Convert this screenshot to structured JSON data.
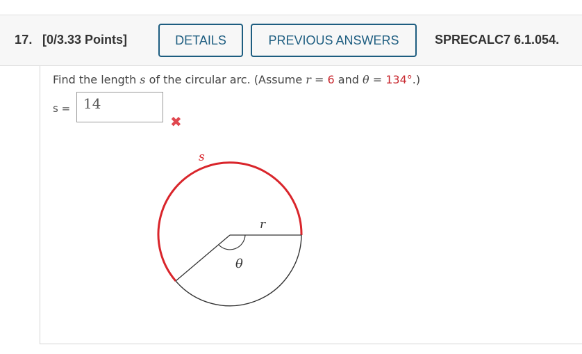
{
  "header": {
    "question_number": "17.",
    "points": "[0/3.33 Points]",
    "details_button": "DETAILS",
    "previous_answers_button": "PREVIOUS ANSWERS",
    "source": "SPRECALC7 6.1.054."
  },
  "question": {
    "prefix": "Find the length ",
    "s_var": "s",
    "middle": " of the circular arc. (Assume ",
    "r_var": "r",
    "eq1": " = ",
    "r_value": "6",
    "and": " and ",
    "theta_var": "θ",
    "eq2": " = ",
    "theta_value": "134°",
    "suffix": ".)"
  },
  "answer": {
    "label": "s =",
    "value": "14",
    "status": "incorrect",
    "status_icon": "x-mark-icon"
  },
  "figure": {
    "arc_label": "s",
    "radius_label": "r",
    "angle_label": "θ",
    "arc_color": "#d9252b",
    "line_color": "#333333"
  }
}
